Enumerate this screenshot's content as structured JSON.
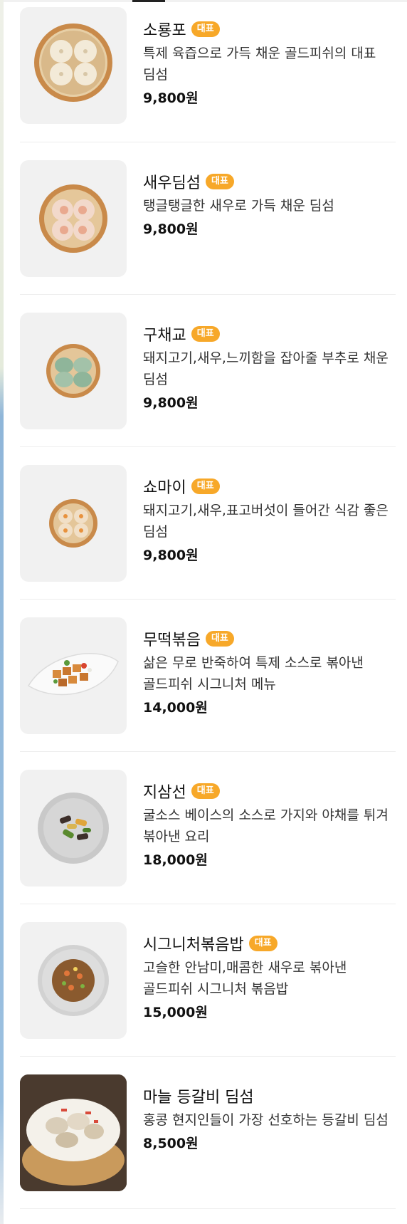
{
  "menu": {
    "items": [
      {
        "name": "소룡포",
        "badge": "대표",
        "desc": "특제 육즙으로 가득 채운 골드피쉬의 대표 딤섬",
        "price": "9,800원",
        "image": "xiaolongbao-steamer-icon"
      },
      {
        "name": "새우딤섬",
        "badge": "대표",
        "desc": "탱글탱글한 새우로 가득 채운 딤섬",
        "price": "9,800원",
        "image": "shrimp-dumpling-steamer-icon"
      },
      {
        "name": "구채교",
        "badge": "대표",
        "desc": "돼지고기,새우,느끼함을 잡아줄 부추로 채운 딤섬",
        "price": "9,800원",
        "image": "chive-dumpling-steamer-icon"
      },
      {
        "name": "쇼마이",
        "badge": "대표",
        "desc": "돼지고기,새우,표고버섯이 들어간 식감 좋은 딤섬",
        "price": "9,800원",
        "image": "shumai-steamer-icon"
      },
      {
        "name": "무떡볶음",
        "badge": "대표",
        "desc": "삶은 무로 반죽하여 특제 소스로 볶아낸 골드피쉬 시그니처 메뉴",
        "price": "14,000원",
        "image": "radish-cake-plate-icon"
      },
      {
        "name": "지삼선",
        "badge": "대표",
        "desc": "굴소스 베이스의 소스로 가지와 야채를 튀겨 볶아낸 요리",
        "price": "18,000원",
        "image": "vegetable-stirfry-plate-icon"
      },
      {
        "name": "시그니처볶음밥",
        "badge": "대표",
        "desc": "고슬한 안남미,매콤한 새우로 볶아낸 골드피쉬 시그니처 볶음밥",
        "price": "15,000원",
        "image": "fried-rice-plate-icon"
      },
      {
        "name": "마늘 등갈비 딤섬",
        "badge": "",
        "desc": "홍콩 현지인들이 가장 선호하는 등갈비 딤섬",
        "price": "8,500원",
        "image": "garlic-ribs-steamer-icon"
      }
    ]
  }
}
